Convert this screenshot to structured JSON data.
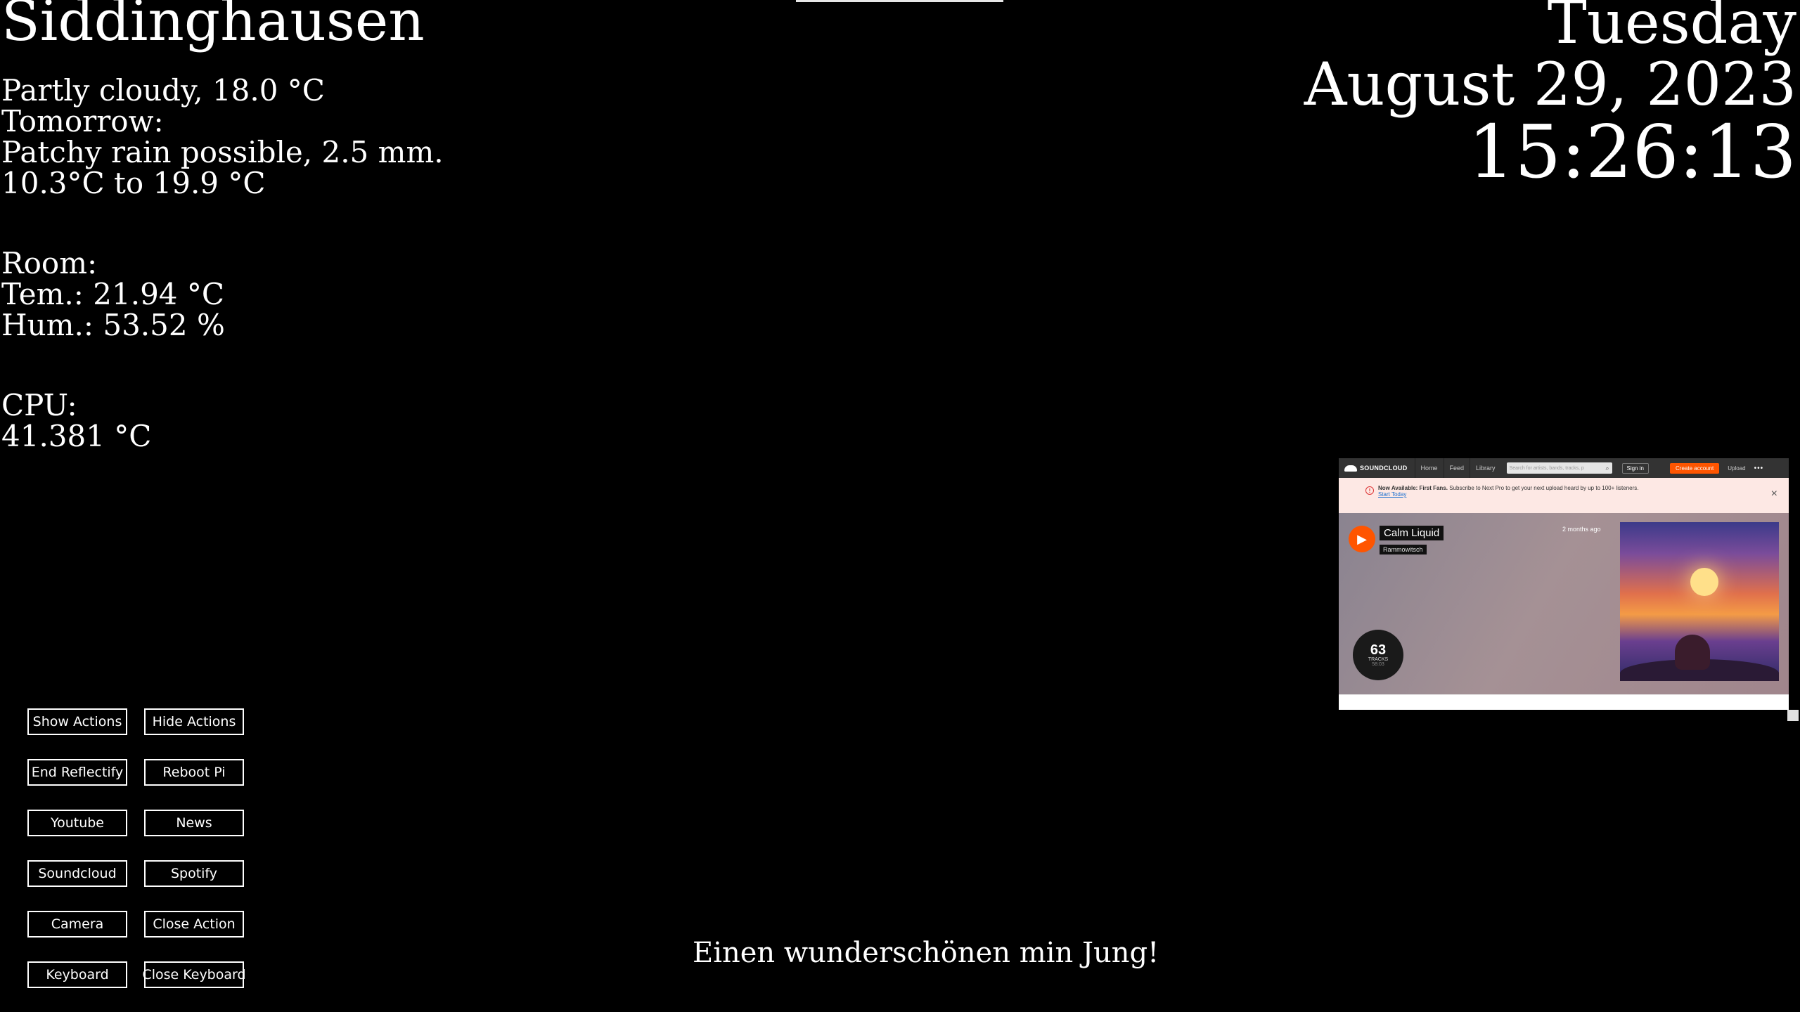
{
  "location": "Siddinghausen",
  "weather": {
    "current": "Partly cloudy, 18.0 °C",
    "tomorrow_label": "Tomorrow:",
    "tomorrow_desc": "Patchy rain possible, 2.5 mm.",
    "tomorrow_range": "10.3°C to 19.9 °C"
  },
  "room": {
    "label": "Room:",
    "temperature": "Tem.: 21.94 °C",
    "humidity": "Hum.: 53.52 %"
  },
  "cpu": {
    "label": "CPU:",
    "temperature": "41.381 °C"
  },
  "datetime": {
    "day": "Tuesday",
    "date": "August 29, 2023",
    "time": "15:26:13"
  },
  "greeting": "Einen wunderschönen min Jung!",
  "buttons": {
    "show_actions": "Show Actions",
    "hide_actions": "Hide Actions",
    "end_reflectify": "End Reflectify",
    "reboot_pi": "Reboot Pi",
    "youtube": "Youtube",
    "news": "News",
    "soundcloud": "Soundcloud",
    "spotify": "Spotify",
    "camera": "Camera",
    "close_action": "Close Action",
    "keyboard": "Keyboard",
    "close_keyboard": "Close Keyboard"
  },
  "soundcloud": {
    "logo": "SOUNDCLOUD",
    "nav": [
      "Home",
      "Feed",
      "Library"
    ],
    "search_placeholder": "Search for artists, bands, tracks, p",
    "sign_in": "Sign in",
    "create_account": "Create account",
    "upload": "Upload",
    "more": "•••",
    "banner_bold": "Now Available: First Fans.",
    "banner_text": "Subscribe to Next Pro to get your next upload heard by up to 100+ listeners.",
    "banner_link": "Start Today",
    "track_title": "Calm Liquid",
    "track_artist": "Rammowitsch",
    "posted": "2 months ago",
    "track_count": "63",
    "tracks_label": "TRACKS",
    "duration": "58:03"
  }
}
